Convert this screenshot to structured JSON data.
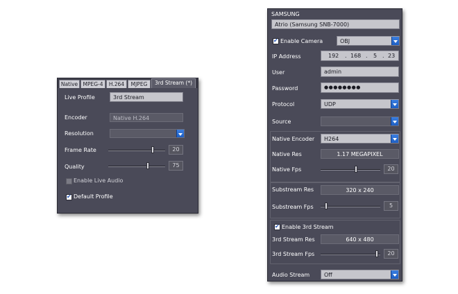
{
  "left_panel": {
    "tabs": [
      "Native",
      "MPEG-4",
      "H.264",
      "MJPEG",
      "3rd Stream (*)"
    ],
    "live_profile_label": "Live Profile",
    "live_profile_value": "3rd Stream",
    "encoder_label": "Encoder",
    "encoder_value": "Native H.264",
    "resolution_label": "Resolution",
    "resolution_value": "",
    "frame_rate_label": "Frame Rate",
    "frame_rate_value": "20",
    "frame_rate_level": 0.8,
    "quality_label": "Quality",
    "quality_value": "75",
    "quality_level": 0.72,
    "enable_live_audio_label": "Enable Live Audio",
    "enable_live_audio_checked": false,
    "default_profile_label": "Default Profile",
    "default_profile_checked": true
  },
  "right_panel": {
    "vendor": "SAMSUNG",
    "camera_name": "Atrio (Samsung SNB-7000)",
    "enable_camera_label": "Enable Camera",
    "enable_camera_checked": true,
    "camera_mode": "OBJ",
    "ip_label": "IP Address",
    "ip_octets": [
      "192",
      "168",
      "5",
      "23"
    ],
    "user_label": "User",
    "user_value": "admin",
    "password_label": "Password",
    "password_value": "●●●●●●●●",
    "protocol_label": "Protocol",
    "protocol_value": "UDP",
    "source_label": "Source",
    "source_value": "",
    "native_encoder_label": "Native Encoder",
    "native_encoder_value": "H264",
    "native_res_label": "Native Res",
    "native_res_value": "1.17 MEGAPIXEL",
    "native_fps_label": "Native Fps",
    "native_fps_value": "20",
    "native_fps_level": 0.6,
    "substream_res_label": "Substream Res",
    "substream_res_value": "320 x 240",
    "substream_fps_label": "Substream Fps",
    "substream_fps_value": "5",
    "substream_fps_level": 0.08,
    "enable_3rd_stream_label": "Enable 3rd Stream",
    "enable_3rd_stream_checked": true,
    "third_res_label": "3rd Stream Res",
    "third_res_value": "640 x 480",
    "third_fps_label": "3rd Stream Fps",
    "third_fps_value": "20",
    "third_fps_level": 0.97,
    "audio_stream_label": "Audio Stream",
    "audio_stream_value": "Off"
  },
  "colors": {
    "panel_bg": "#4a4a58",
    "accent_blue": "#2a6fd6",
    "field_bg": "#c6c6cc"
  }
}
